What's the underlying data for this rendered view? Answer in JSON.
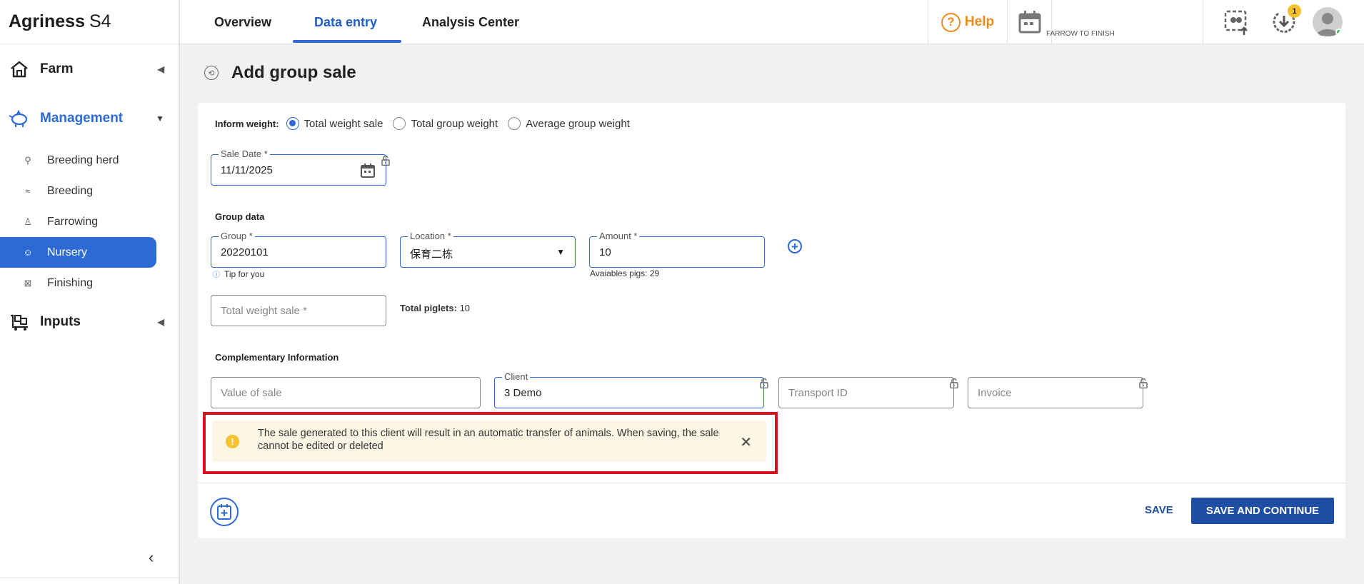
{
  "app": {
    "brand_bold": "Agriness",
    "brand_suffix": "S4"
  },
  "sidebar": {
    "sections": [
      {
        "label": "Farm",
        "icon": "farm-house-icon"
      },
      {
        "label": "Management",
        "icon": "pig-icon"
      },
      {
        "label": "Inputs",
        "icon": "inputs-cart-icon"
      }
    ],
    "items": [
      {
        "label": "Breeding herd",
        "icon": "breeding-herd-icon"
      },
      {
        "label": "Breeding",
        "icon": "breeding-icon"
      },
      {
        "label": "Farrowing",
        "icon": "farrowing-icon"
      },
      {
        "label": "Nursery",
        "icon": "nursery-icon"
      },
      {
        "label": "Finishing",
        "icon": "finishing-icon"
      }
    ],
    "collapse_glyph": "‹"
  },
  "topbar": {
    "tabs": [
      "Overview",
      "Data entry",
      "Analysis Center"
    ],
    "help_label": "Help",
    "farm_type": "FARROW TO FINISH",
    "notification_count": "1"
  },
  "page": {
    "title": "Add group sale"
  },
  "form": {
    "inform_weight_label": "Inform weight:",
    "weight_options": [
      "Total weight sale",
      "Total group weight",
      "Average group weight"
    ],
    "sale_date": {
      "label": "Sale Date *",
      "value": "11/11/2025"
    },
    "group_data_title": "Group data",
    "group": {
      "label": "Group *",
      "value": "20220101"
    },
    "location": {
      "label": "Location *",
      "value": "保育二栋"
    },
    "amount": {
      "label": "Amount *",
      "value": "10"
    },
    "tip": "Tip for you",
    "available_pigs": "Avaiables pigs: 29",
    "total_weight_placeholder": "Total weight sale *",
    "total_piglets_label": "Total piglets:",
    "total_piglets_value": "10",
    "complementary_title": "Complementary Information",
    "value_of_sale_placeholder": "Value of sale",
    "client": {
      "label": "Client",
      "value": "3 Demo"
    },
    "transport_placeholder": "Transport ID",
    "invoice_placeholder": "Invoice"
  },
  "alert": {
    "text": "The sale generated to this client will result in an automatic transfer of animals. When saving, the sale cannot be edited or deleted"
  },
  "actions": {
    "save": "SAVE",
    "save_continue": "SAVE AND CONTINUE"
  },
  "colors": {
    "primary": "#2d6ad6",
    "dark_primary": "#1e4fa5",
    "help": "#f08a1c",
    "warning": "#f5c12e",
    "highlight": "#d9131e"
  }
}
